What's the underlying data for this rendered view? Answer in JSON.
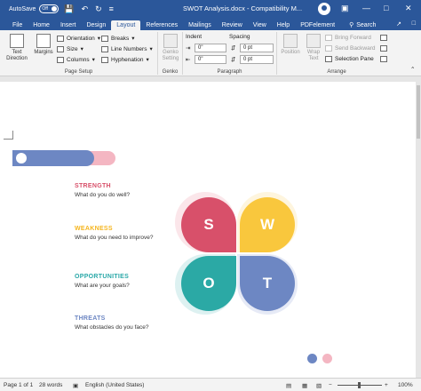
{
  "titlebar": {
    "autosave_label": "AutoSave",
    "autosave_state": "Off",
    "doc_title": "SWOT Analysis.docx  -  Compatibility M..."
  },
  "tabs": [
    {
      "label": "File"
    },
    {
      "label": "Home"
    },
    {
      "label": "Insert"
    },
    {
      "label": "Design"
    },
    {
      "label": "Layout",
      "active": true
    },
    {
      "label": "References"
    },
    {
      "label": "Mailings"
    },
    {
      "label": "Review"
    },
    {
      "label": "View"
    },
    {
      "label": "Help"
    },
    {
      "label": "PDFelement"
    }
  ],
  "search_label": "Search",
  "ribbon": {
    "page_setup": {
      "label": "Page Setup",
      "text_direction": "Text Direction",
      "margins": "Margins",
      "orientation": "Orientation",
      "size": "Size",
      "columns": "Columns",
      "breaks": "Breaks",
      "line_numbers": "Line Numbers",
      "hyphenation": "Hyphenation"
    },
    "genko": {
      "label": "Genko",
      "button": "Genko Setting"
    },
    "paragraph": {
      "label": "Paragraph",
      "indent_label": "Indent",
      "spacing_label": "Spacing",
      "indent_left": "0\"",
      "indent_right": "0\"",
      "spacing_before": "0 pt",
      "spacing_after": "0 pt"
    },
    "arrange": {
      "label": "Arrange",
      "position": "Position",
      "wrap_text": "Wrap Text",
      "bring_forward": "Bring Forward",
      "send_backward": "Send Backward",
      "selection_pane": "Selection Pane"
    }
  },
  "document": {
    "swot_items": [
      {
        "heading": "STRENGTH",
        "question": "What do you do well?",
        "color": "#d8506a"
      },
      {
        "heading": "WEAKNESS",
        "question": "What do you need to improve?",
        "color": "#f5b51e"
      },
      {
        "heading": "OPPORTUNITIES",
        "question": "What are your goals?",
        "color": "#2aa8a8"
      },
      {
        "heading": "THREATS",
        "question": "What obstacles do you face?",
        "color": "#6d87c3"
      }
    ],
    "letters": {
      "s": "S",
      "w": "W",
      "o": "O",
      "t": "T"
    },
    "colors": {
      "strength": "#d8506a",
      "weakness": "#f9c73d",
      "opportunities": "#2ba9a5",
      "threats": "#6d87c3",
      "pink": "#f4b6c2"
    }
  },
  "statusbar": {
    "page": "Page 1 of 1",
    "words": "28 words",
    "language": "English (United States)",
    "zoom": "100%"
  }
}
